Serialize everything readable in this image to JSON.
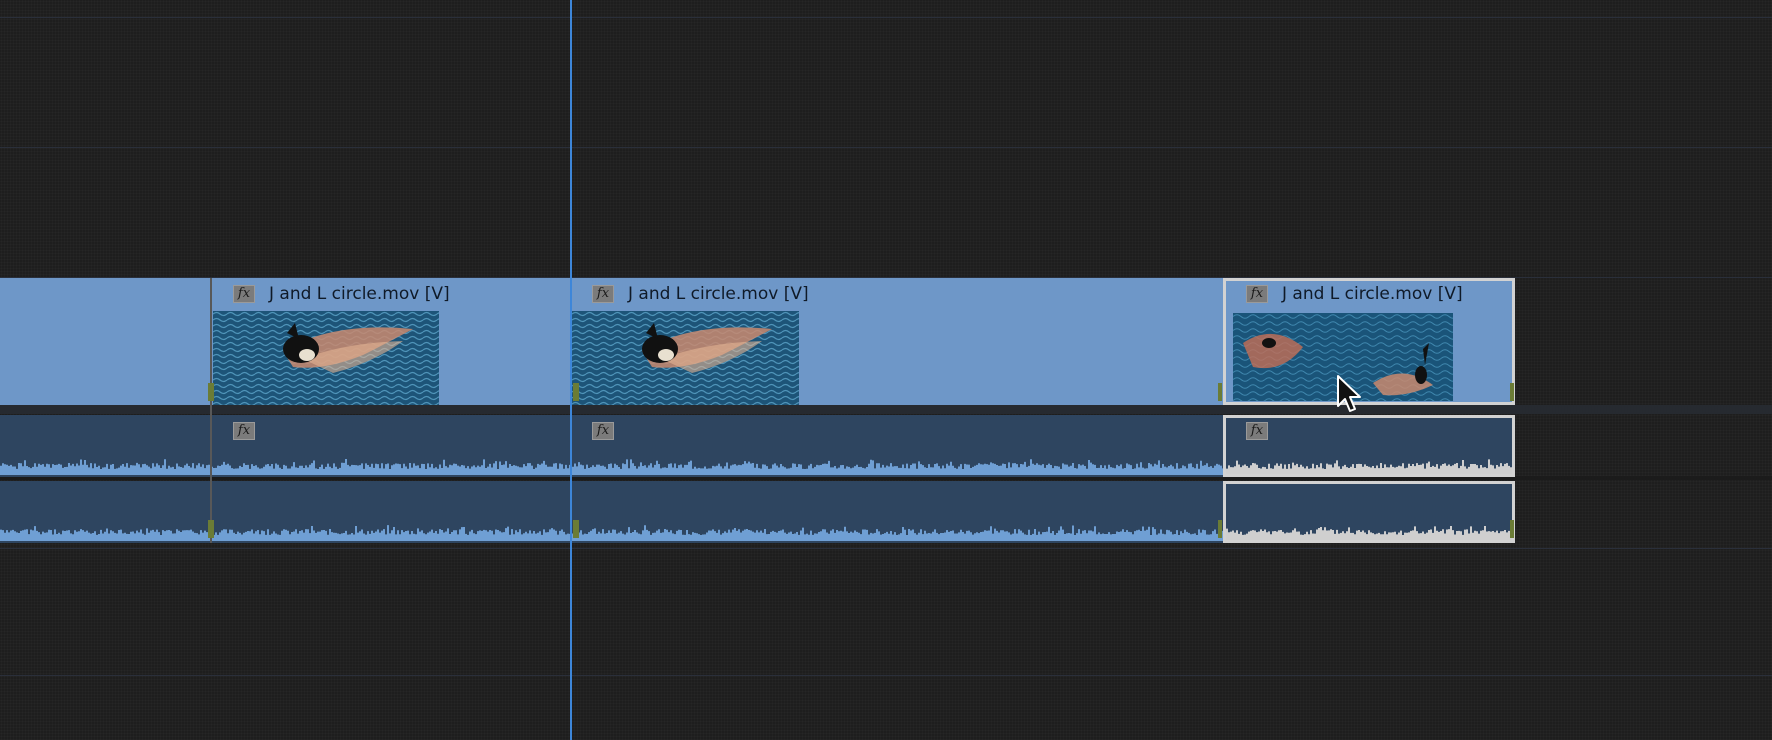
{
  "clips": {
    "clip1": {
      "name": "J and L circle.mov [V]",
      "fx": "fx",
      "audio_fx": "fx"
    },
    "clip2": {
      "name": "J and L circle.mov [V]",
      "fx": "fx",
      "audio_fx": "fx"
    },
    "clip3": {
      "name": "J and L circle.mov [V]",
      "fx": "fx",
      "audio_fx": "fx"
    }
  },
  "colors": {
    "video_clip": "#6e97c8",
    "audio_clip": "#2e4560",
    "selection_border": "#d2d2d2",
    "playhead": "#3d86d9",
    "background": "#1e1e1e"
  },
  "icons": [
    "fx-badge",
    "mouse-cursor-icon",
    "playhead-line"
  ]
}
